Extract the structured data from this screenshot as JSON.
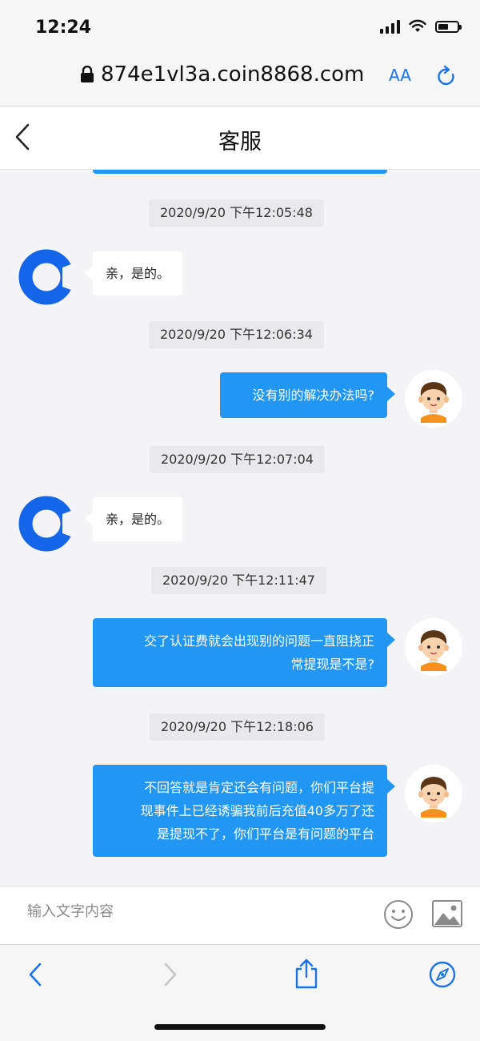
{
  "status": {
    "time": "12:24"
  },
  "browser": {
    "url": "874e1vl3a.coin8868.com",
    "text_size_label": "AA"
  },
  "header": {
    "title": "客服"
  },
  "messages": [
    {
      "type": "timestamp",
      "text": "2020/9/20 下午12:05:48"
    },
    {
      "type": "in",
      "text": "亲，是的。"
    },
    {
      "type": "timestamp",
      "text": "2020/9/20 下午12:06:34"
    },
    {
      "type": "out",
      "lines": [
        "没有别的解决办法吗?"
      ]
    },
    {
      "type": "timestamp",
      "text": "2020/9/20 下午12:07:04"
    },
    {
      "type": "in",
      "text": "亲，是的。"
    },
    {
      "type": "timestamp",
      "text": "2020/9/20 下午12:11:47"
    },
    {
      "type": "out",
      "lines": [
        "交了认证费就会出现别的问题一直阻挠正",
        "常提现是不是?"
      ]
    },
    {
      "type": "timestamp",
      "text": "2020/9/20 下午12:18:06"
    },
    {
      "type": "out",
      "lines": [
        "不回答就是肯定还会有问题，你们平台提",
        "现事件上已经诱骗我前后充值40多万了还",
        "是提现不了，你们平台是有问题的平台"
      ]
    }
  ],
  "composer": {
    "placeholder": "输入文字内容"
  },
  "colors": {
    "accent": "#2196f3",
    "agent_logo": "#1565e8"
  },
  "icons": [
    "lock-icon",
    "refresh-icon",
    "back-icon",
    "emoji-icon",
    "image-icon",
    "share-icon",
    "compass-icon"
  ]
}
